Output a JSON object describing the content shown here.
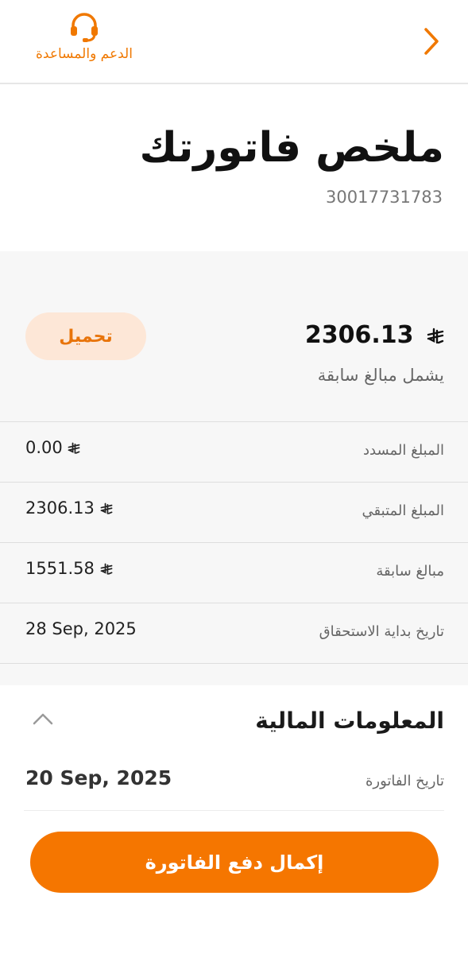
{
  "header": {
    "back_icon": "chevron-right-icon",
    "support_icon": "headset-icon",
    "support_label": "الدعم والمساعدة"
  },
  "title": {
    "page_title": "ملخص فاتورتك",
    "invoice_number": "30017731783"
  },
  "summary": {
    "total_amount": "2306.13",
    "total_note": "يشمل مبالغ سابقة",
    "download_label": "تحميل",
    "currency_icon": "riyal-symbol-icon",
    "rows": [
      {
        "label": "المبلغ المسدد",
        "value": "0.00",
        "has_currency": true
      },
      {
        "label": "المبلغ المتبقي",
        "value": "2306.13",
        "has_currency": true
      },
      {
        "label": "مبالغ سابقة",
        "value": "1551.58",
        "has_currency": true
      },
      {
        "label": "تاريخ بداية الاستحقاق",
        "value": "28 Sep, 2025",
        "has_currency": false
      }
    ]
  },
  "financial": {
    "title": "المعلومات المالية",
    "invoice_date_label": "تاريخ الفاتورة",
    "invoice_date_value": "20 Sep, 2025",
    "collapse_icon": "chevron-up-icon"
  },
  "pay_button_label": "إكمال دفع الفاتورة",
  "colors": {
    "accent": "#f57600",
    "download_bg": "#fde7d7",
    "summary_bg": "#f7f7f7"
  }
}
